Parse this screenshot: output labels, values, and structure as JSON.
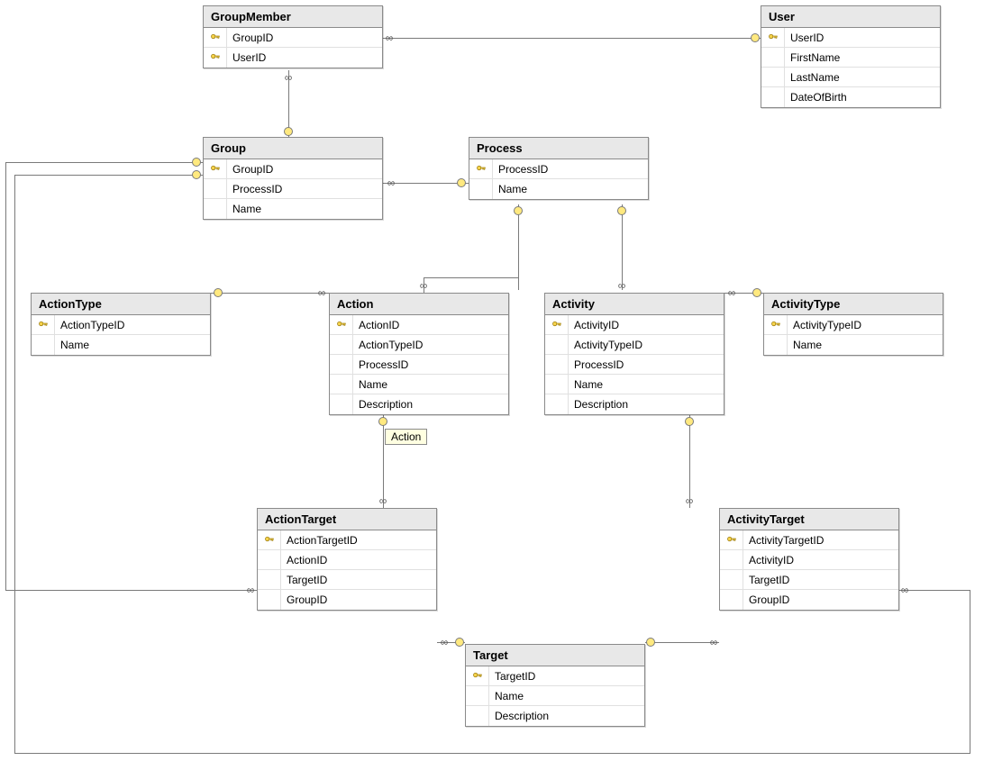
{
  "tooltip": "Action",
  "entities": {
    "GroupMember": {
      "title": "GroupMember",
      "fields": [
        {
          "name": "GroupID",
          "pk": true
        },
        {
          "name": "UserID",
          "pk": true
        }
      ]
    },
    "User": {
      "title": "User",
      "fields": [
        {
          "name": "UserID",
          "pk": true
        },
        {
          "name": "FirstName",
          "pk": false
        },
        {
          "name": "LastName",
          "pk": false
        },
        {
          "name": "DateOfBirth",
          "pk": false
        }
      ]
    },
    "Group": {
      "title": "Group",
      "fields": [
        {
          "name": "GroupID",
          "pk": true
        },
        {
          "name": "ProcessID",
          "pk": false
        },
        {
          "name": "Name",
          "pk": false
        }
      ]
    },
    "Process": {
      "title": "Process",
      "fields": [
        {
          "name": "ProcessID",
          "pk": true
        },
        {
          "name": "Name",
          "pk": false
        }
      ]
    },
    "ActionType": {
      "title": "ActionType",
      "fields": [
        {
          "name": "ActionTypeID",
          "pk": true
        },
        {
          "name": "Name",
          "pk": false
        }
      ]
    },
    "Action": {
      "title": "Action",
      "fields": [
        {
          "name": "ActionID",
          "pk": true
        },
        {
          "name": "ActionTypeID",
          "pk": false
        },
        {
          "name": "ProcessID",
          "pk": false
        },
        {
          "name": "Name",
          "pk": false
        },
        {
          "name": "Description",
          "pk": false
        }
      ]
    },
    "Activity": {
      "title": "Activity",
      "fields": [
        {
          "name": "ActivityID",
          "pk": true
        },
        {
          "name": "ActivityTypeID",
          "pk": false
        },
        {
          "name": "ProcessID",
          "pk": false
        },
        {
          "name": "Name",
          "pk": false
        },
        {
          "name": "Description",
          "pk": false
        }
      ]
    },
    "ActivityType": {
      "title": "ActivityType",
      "fields": [
        {
          "name": "ActivityTypeID",
          "pk": true
        },
        {
          "name": "Name",
          "pk": false
        }
      ]
    },
    "ActionTarget": {
      "title": "ActionTarget",
      "fields": [
        {
          "name": "ActionTargetID",
          "pk": true
        },
        {
          "name": "ActionID",
          "pk": false
        },
        {
          "name": "TargetID",
          "pk": false
        },
        {
          "name": "GroupID",
          "pk": false
        }
      ]
    },
    "ActivityTarget": {
      "title": "ActivityTarget",
      "fields": [
        {
          "name": "ActivityTargetID",
          "pk": true
        },
        {
          "name": "ActivityID",
          "pk": false
        },
        {
          "name": "TargetID",
          "pk": false
        },
        {
          "name": "GroupID",
          "pk": false
        }
      ]
    },
    "Target": {
      "title": "Target",
      "fields": [
        {
          "name": "TargetID",
          "pk": true
        },
        {
          "name": "Name",
          "pk": false
        },
        {
          "name": "Description",
          "pk": false
        }
      ]
    }
  }
}
